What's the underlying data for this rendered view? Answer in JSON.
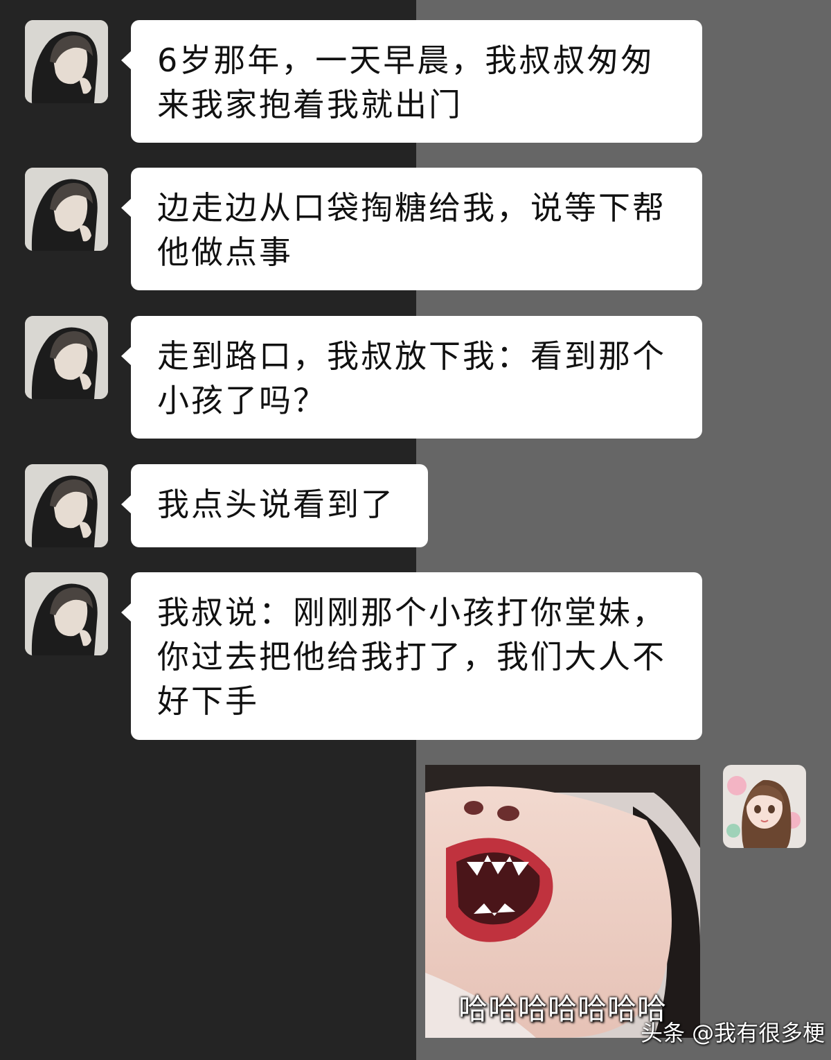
{
  "messages": [
    {
      "text": "6岁那年，一天早晨，我叔叔匆匆来我家抱着我就出门"
    },
    {
      "text": "边走边从口袋掏糖给我，说等下帮他做点事"
    },
    {
      "text": "走到路口，我叔放下我：看到那个小孩了吗？"
    },
    {
      "text": "我点头说看到了"
    },
    {
      "text": "我叔说：刚刚那个小孩打你堂妹，你过去把他给我打了，我们大人不好下手"
    }
  ],
  "reply": {
    "caption": "哈哈哈哈哈哈哈"
  },
  "watermark": "头条 @我有很多梗",
  "colors": {
    "left_background": "#242424",
    "right_background": "#666666",
    "bubble": "#ffffff"
  },
  "icons": {
    "sender_avatar": "dark-haired-man-avatar",
    "self_avatar": "girl-with-flowers-avatar"
  }
}
